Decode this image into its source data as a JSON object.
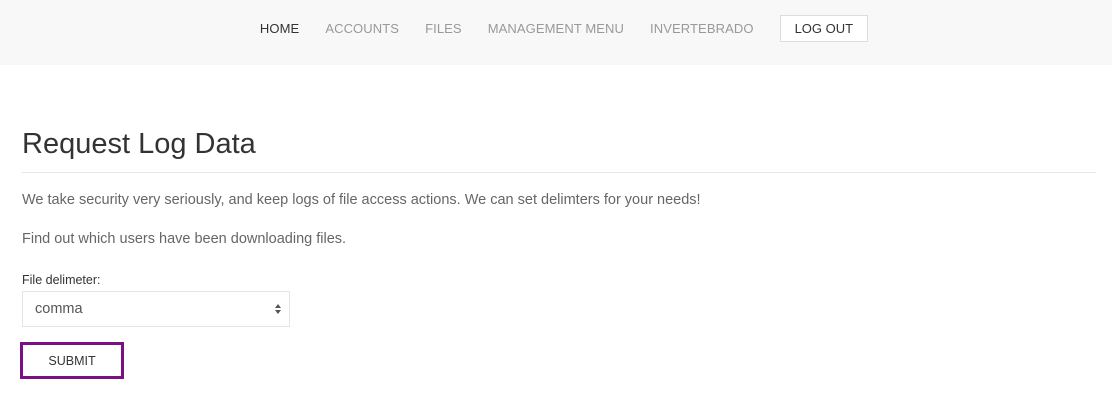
{
  "nav": {
    "items": [
      {
        "label": "HOME",
        "active": true
      },
      {
        "label": "ACCOUNTS",
        "active": false
      },
      {
        "label": "FILES",
        "active": false
      },
      {
        "label": "MANAGEMENT MENU",
        "active": false
      },
      {
        "label": "INVERTEBRADO",
        "active": false
      }
    ],
    "logout_label": "LOG OUT"
  },
  "main": {
    "title": "Request Log Data",
    "paragraph_1": "We take security very seriously, and keep logs of file access actions. We can set delimters for your needs!",
    "paragraph_2": "Find out which users have been downloading files.",
    "delimiter_field": {
      "label": "File delimeter:",
      "selected_value": "comma"
    },
    "submit_label": "SUBMIT"
  },
  "colors": {
    "navbar_bg": "#f8f8f8",
    "nav_inactive": "#999999",
    "nav_active": "#333333",
    "focus_outline": "#7b0f85"
  },
  "icons": {
    "select_arrow": "sort-updown-icon"
  }
}
